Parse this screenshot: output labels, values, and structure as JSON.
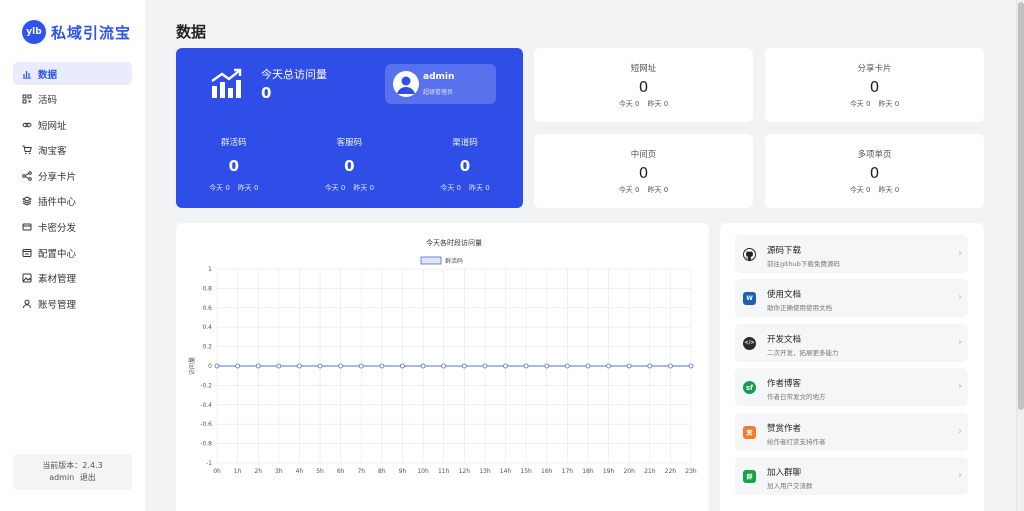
{
  "app": {
    "logo_badge": "ylb",
    "logo_text": "私域引流宝",
    "brand_color": "#2f54eb"
  },
  "sidebar": {
    "items": [
      {
        "label": "数据",
        "icon": "chart-bar-icon",
        "active": true
      },
      {
        "label": "活码",
        "icon": "qrcode-icon"
      },
      {
        "label": "短网址",
        "icon": "link-icon"
      },
      {
        "label": "淘宝客",
        "icon": "cart-icon"
      },
      {
        "label": "分享卡片",
        "icon": "share-icon"
      },
      {
        "label": "插件中心",
        "icon": "layers-icon"
      },
      {
        "label": "卡密分发",
        "icon": "card-icon"
      },
      {
        "label": "配置中心",
        "icon": "config-icon"
      },
      {
        "label": "素材管理",
        "icon": "image-icon"
      },
      {
        "label": "账号管理",
        "icon": "user-icon"
      }
    ],
    "version_label": "当前版本：2.4.3",
    "user_name": "admin",
    "logout_label": "退出"
  },
  "main": {
    "title": "数据",
    "hero": {
      "label": "今天总访问量",
      "value": "0",
      "admin_name": "admin",
      "admin_role": "超级管理员",
      "stats": [
        {
          "label": "群活码",
          "value": "0",
          "today": "今天 0",
          "yesterday": "昨天 0"
        },
        {
          "label": "客服码",
          "value": "0",
          "today": "今天 0",
          "yesterday": "昨天 0"
        },
        {
          "label": "渠道码",
          "value": "0",
          "today": "今天 0",
          "yesterday": "昨天 0"
        }
      ]
    },
    "cards": [
      {
        "label": "短网址",
        "value": "0",
        "today": "今天 0",
        "yesterday": "昨天 0"
      },
      {
        "label": "分享卡片",
        "value": "0",
        "today": "今天 0",
        "yesterday": "昨天 0"
      },
      {
        "label": "中间页",
        "value": "0",
        "today": "今天 0",
        "yesterday": "昨天 0"
      },
      {
        "label": "多项单页",
        "value": "0",
        "today": "今天 0",
        "yesterday": "昨天 0"
      }
    ],
    "links": [
      {
        "title": "源码下载",
        "desc": "前往github下载免费源码",
        "icon": "github-icon",
        "color": "#222222",
        "glyph": ""
      },
      {
        "title": "使用文档",
        "desc": "助你正确使用使用文档",
        "icon": "doc-icon",
        "color": "#1d5fb5",
        "glyph": "W"
      },
      {
        "title": "开发文档",
        "desc": "二次开发，拓展更多能力",
        "icon": "code-icon",
        "color": "#2b2b2b",
        "glyph": "</>"
      },
      {
        "title": "作者博客",
        "desc": "作者日常发文的地方",
        "icon": "blog-icon",
        "color": "#149f4e",
        "glyph": "sf"
      },
      {
        "title": "赞赏作者",
        "desc": "给作者打赏支持作者",
        "icon": "reward-icon",
        "color": "#f07c2c",
        "glyph": "赏"
      },
      {
        "title": "加入群聊",
        "desc": "加入用户交流群",
        "icon": "group-icon",
        "color": "#16a34a",
        "glyph": "群"
      }
    ]
  },
  "chart_data": {
    "type": "line",
    "title": "今天各时段访问量",
    "ylabel": "访问量",
    "xlabel": "",
    "categories": [
      "0h",
      "1h",
      "2h",
      "3h",
      "4h",
      "5h",
      "6h",
      "7h",
      "8h",
      "9h",
      "10h",
      "11h",
      "12h",
      "13h",
      "14h",
      "15h",
      "16h",
      "17h",
      "18h",
      "19h",
      "20h",
      "21h",
      "22h",
      "23h"
    ],
    "series": [
      {
        "name": "群活码",
        "values": [
          0,
          0,
          0,
          0,
          0,
          0,
          0,
          0,
          0,
          0,
          0,
          0,
          0,
          0,
          0,
          0,
          0,
          0,
          0,
          0,
          0,
          0,
          0,
          0
        ]
      }
    ],
    "ylim": [
      -1.0,
      1.0
    ],
    "yticks": [
      1.0,
      0.8,
      0.6,
      0.4,
      0.2,
      0,
      -0.2,
      -0.4,
      -0.6,
      -0.8,
      -1.0
    ],
    "grid": true,
    "legend": "top-center",
    "line_color": "#5470c6"
  }
}
